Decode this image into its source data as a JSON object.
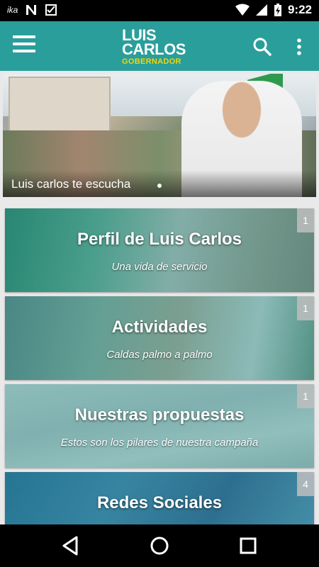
{
  "status_bar": {
    "time": "9:22"
  },
  "app_bar": {
    "logo": {
      "line1": "LUIS",
      "line2": "CARLOS",
      "sub": "GOBERNADOR"
    },
    "icons": {
      "menu": "hamburger-menu-icon",
      "search": "search-icon",
      "more": "more-vert-icon"
    }
  },
  "banner": {
    "caption": "Luis carlos te escucha"
  },
  "cards": [
    {
      "title": "Perfil de Luis Carlos",
      "subtitle": "Una vida de servicio",
      "badge": "1"
    },
    {
      "title": "Actividades",
      "subtitle": "Caldas palmo a palmo",
      "badge": "1"
    },
    {
      "title": "Nuestras propuestas",
      "subtitle": "Estos son los pilares de nuestra campaña",
      "badge": "1"
    },
    {
      "title": "Redes Sociales",
      "subtitle": "",
      "badge": "4"
    }
  ],
  "colors": {
    "primary": "#2a9e9a",
    "logo_accent": "#f5d500"
  }
}
